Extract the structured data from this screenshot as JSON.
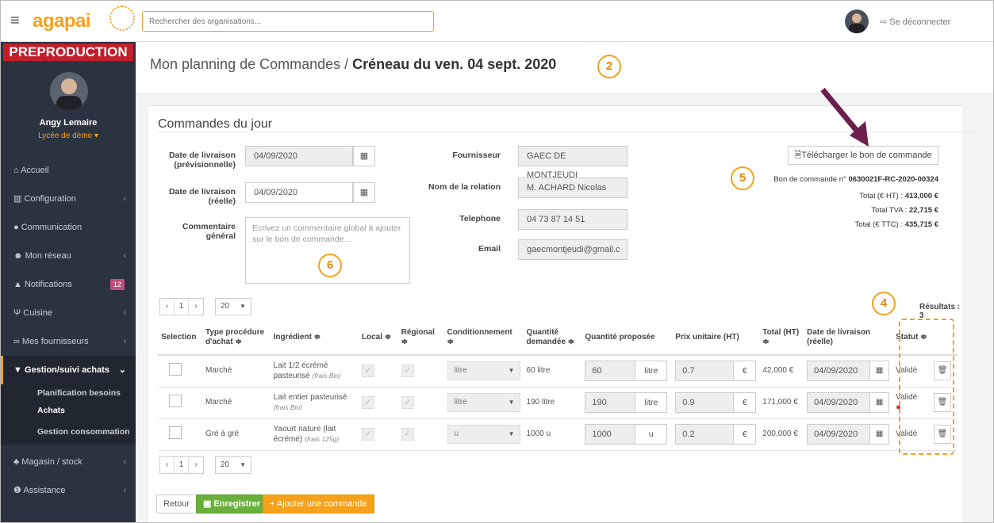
{
  "header": {
    "brand": "agapai",
    "search_placeholder": "Rechercher des organisations...",
    "logout": "Se déconnecter"
  },
  "sidebar": {
    "env_badge": "PREPRODUCTION",
    "user_name": "Angy Lemaire",
    "school": "Lycée de démo ▾",
    "items": [
      {
        "label": "Accueil",
        "icon": "home-icon"
      },
      {
        "label": "Configuration",
        "icon": "bank-icon"
      },
      {
        "label": "Communication",
        "icon": "chat-icon"
      },
      {
        "label": "Mon réseau",
        "icon": "users-icon"
      },
      {
        "label": "Notifications",
        "icon": "bell-icon",
        "badge": "12"
      },
      {
        "label": "Cuisine",
        "icon": "cutlery-icon"
      },
      {
        "label": "Mes fournisseurs",
        "icon": "handshake-icon"
      },
      {
        "label": "Gestion/suivi achats",
        "icon": "cart-icon"
      },
      {
        "label": "Magasin / stock",
        "icon": "cubes-icon"
      },
      {
        "label": "Assistance",
        "icon": "info-icon"
      }
    ],
    "sub_items": [
      "Planification besoins",
      "Achats",
      "Gestion consommation"
    ]
  },
  "page": {
    "title_prefix": "Mon planning de Commandes / ",
    "title_strong": "Créneau du ven. 04 sept. 2020"
  },
  "annotations": {
    "c2": "2",
    "c4": "4",
    "c5": "5",
    "c6": "6"
  },
  "panel": {
    "title": "Commandes du jour",
    "delivery_planned_label": "Date de livraison (prévisionnelle)",
    "delivery_planned_value": "04/09/2020",
    "delivery_real_label": "Date de livraison (réelle)",
    "delivery_real_value": "04/09/2020",
    "comment_label": "Commentaire général",
    "comment_placeholder": "Ecrivez un commentaire global à ajouter sur le bon de commande...",
    "supplier_label": "Fournisseur",
    "supplier_value": "GAEC DE MONTJEUDI",
    "relation_label": "Nom de la relation",
    "relation_value": "M. ACHARD Nicolas",
    "phone_label": "Telephone",
    "phone_value": "04 73 87 14 51",
    "email_label": "Email",
    "email_value": "gaecmontjeudi@gmail.c",
    "download_btn": "Télécharger le bon de commande",
    "order_prefix": "Bon de commande n° ",
    "order_no": "0630021F-RC-2020-00324",
    "total_ht_label": "Total (€ HT) : ",
    "total_ht": "413,000 €",
    "total_tva_label": "Total TVA : ",
    "total_tva": "22,715 €",
    "total_ttc_label": "Total (€ TTC) : ",
    "total_ttc": "435,715 €",
    "results": "Résultats : 3",
    "page_num": "1",
    "page_size": "20",
    "btn_back": "Retour",
    "btn_save": "Enregistrer",
    "btn_add": "+ Ajouter une commande"
  },
  "table": {
    "headers": [
      "Selection",
      "Type procédure d'achat ≑",
      "Ingrédient ≑",
      "Local ≑",
      "Régional ≑",
      "Conditionnement ≑",
      "Quantité demandée ≑",
      "Quantité proposée",
      "Prix unitaire (HT)",
      "Total (HT) ≑",
      "Date de livraison (réelle)",
      "Statut ≑"
    ],
    "rows": [
      {
        "type": "Marché",
        "ingredient": "Lait 1/2 écrémé pasteurisé",
        "note": "(frais Bio)",
        "cond": "litre",
        "qty_req": "60 litre",
        "qty_prop": "60",
        "unit": "litre",
        "price": "0.7",
        "total": "42,000 €",
        "date": "04/09/2020",
        "status": "Validé"
      },
      {
        "type": "Marché",
        "ingredient": "Lait entier pasteurisé",
        "note": "(frais Bio)",
        "cond": "litre",
        "qty_req": "190 litre",
        "qty_prop": "190",
        "unit": "litre",
        "price": "0.9",
        "total": "171,000 €",
        "date": "04/09/2020",
        "status": "Validé"
      },
      {
        "type": "Gré à gré",
        "ingredient": "Yaourt nature (lait écrémé)",
        "note": "(frais 125g)",
        "cond": "u",
        "qty_req": "1000 u",
        "qty_prop": "1000",
        "unit": "u",
        "price": "0.2",
        "total": "200,000 €",
        "date": "04/09/2020",
        "status": "Validé"
      }
    ]
  },
  "colors": {
    "accent": "#f5a21b",
    "sidebar": "#2c3340",
    "preprod": "#c0202c",
    "save": "#6aaf3c",
    "arrow": "#6b1f4a"
  }
}
